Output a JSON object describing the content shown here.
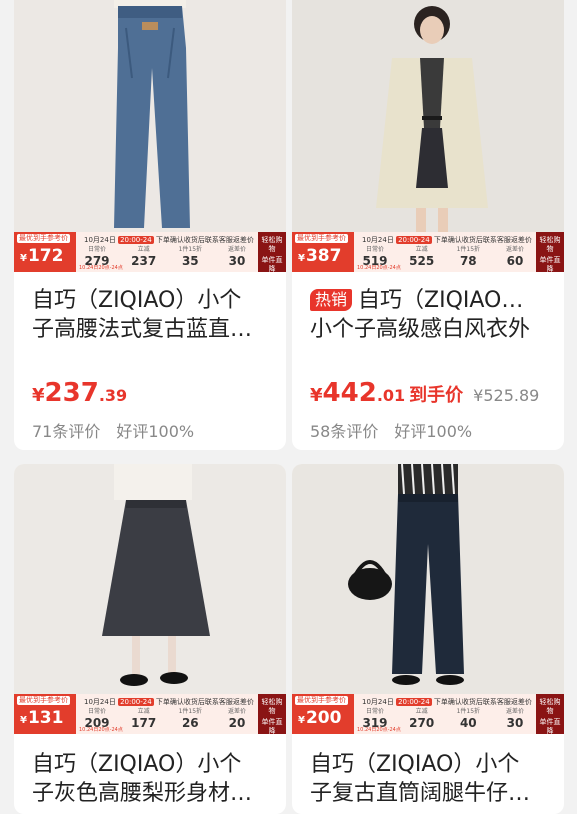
{
  "products": [
    {
      "banner": {
        "tag": "最优到手参考价",
        "price": "172",
        "top_text_date": "10月24日",
        "top_text_hl": "20:00-24",
        "top_text_rest": "下单确认收货后联系客服返差价",
        "cols": [
          {
            "label": "日常价",
            "value": "279"
          },
          {
            "label": "立减",
            "value": "237"
          },
          {
            "label": "1件15折",
            "value": "35"
          },
          {
            "label": "返差价",
            "value": "30"
          }
        ],
        "date_range": "10.24日20点-24点",
        "right_top": "轻松购物",
        "right_bottom": "单件直降"
      },
      "title_line1": "自巧（ZIQIAO）小个",
      "title_line2": "子高腰法式复古蓝直…",
      "hot": "",
      "price_symbol": "¥",
      "price_int": "237",
      "price_dec": ".39",
      "price_tag": "",
      "orig_price": "",
      "reviews": "71条评价",
      "good_rate": "好评100%"
    },
    {
      "banner": {
        "tag": "最优到手参考价",
        "price": "387",
        "top_text_date": "10月24日",
        "top_text_hl": "20:00-24",
        "top_text_rest": "下单确认收货后联系客服返差价",
        "cols": [
          {
            "label": "日常价",
            "value": "519"
          },
          {
            "label": "立减",
            "value": "525"
          },
          {
            "label": "1件15折",
            "value": "78"
          },
          {
            "label": "返差价",
            "value": "60"
          }
        ],
        "date_range": "10.24日20点-24点",
        "right_top": "轻松购物",
        "right_bottom": "单件直降"
      },
      "title_line1": "自巧（ZIQIAO…",
      "title_line2": "小个子高级感白风衣外",
      "hot": "热销",
      "price_symbol": "¥",
      "price_int": "442",
      "price_dec": ".01",
      "price_tag": "到手价",
      "orig_price": "¥525.89",
      "reviews": "58条评价",
      "good_rate": "好评100%"
    },
    {
      "banner": {
        "tag": "最优到手参考价",
        "price": "131",
        "top_text_date": "10月24日",
        "top_text_hl": "20:00-24",
        "top_text_rest": "下单确认收货后联系客服返差价",
        "cols": [
          {
            "label": "日常价",
            "value": "209"
          },
          {
            "label": "立减",
            "value": "177"
          },
          {
            "label": "1件15折",
            "value": "26"
          },
          {
            "label": "返差价",
            "value": "20"
          }
        ],
        "date_range": "10.24日20点-24点",
        "right_top": "轻松购物",
        "right_bottom": "单件直降"
      },
      "title_line1": "自巧（ZIQIAO）小个",
      "title_line2": "子灰色高腰梨形身材…"
    },
    {
      "banner": {
        "tag": "最优到手参考价",
        "price": "200",
        "top_text_date": "10月24日",
        "top_text_hl": "20:00-24",
        "top_text_rest": "下单确认收货后联系客服返差价",
        "cols": [
          {
            "label": "日常价",
            "value": "319"
          },
          {
            "label": "立减",
            "value": "270"
          },
          {
            "label": "1件15折",
            "value": "40"
          },
          {
            "label": "返差价",
            "value": "30"
          }
        ],
        "date_range": "10.24日20点-24点",
        "right_top": "轻松购物",
        "right_bottom": "单件直降"
      },
      "title_line1": "自巧（ZIQIAO）小个",
      "title_line2": "子复古直筒阔腿牛仔…"
    }
  ],
  "colors": {
    "accent_red": "#e8352b",
    "banner_red": "#e23d2c",
    "banner_dark": "#8a1414"
  },
  "icons": [
    "product-photo-jeans",
    "product-photo-trench-coat",
    "product-photo-gray-skirt",
    "product-photo-dark-jeans"
  ]
}
